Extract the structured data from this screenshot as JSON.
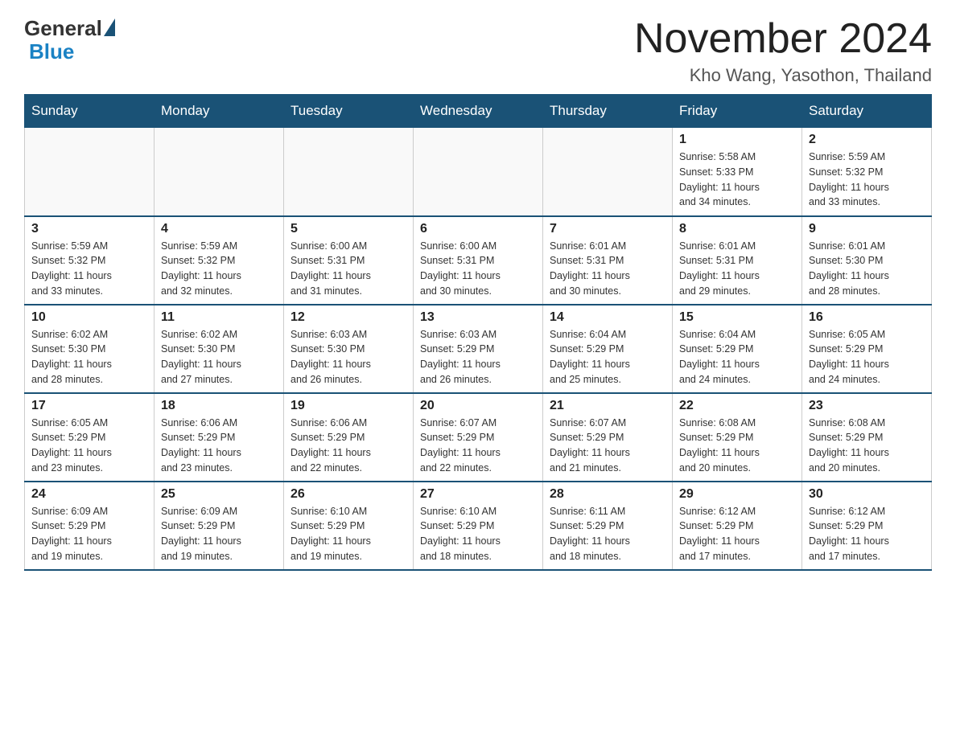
{
  "logo": {
    "general": "General",
    "blue": "Blue"
  },
  "header": {
    "title": "November 2024",
    "location": "Kho Wang, Yasothon, Thailand"
  },
  "weekdays": [
    "Sunday",
    "Monday",
    "Tuesday",
    "Wednesday",
    "Thursday",
    "Friday",
    "Saturday"
  ],
  "weeks": [
    [
      {
        "day": "",
        "info": ""
      },
      {
        "day": "",
        "info": ""
      },
      {
        "day": "",
        "info": ""
      },
      {
        "day": "",
        "info": ""
      },
      {
        "day": "",
        "info": ""
      },
      {
        "day": "1",
        "info": "Sunrise: 5:58 AM\nSunset: 5:33 PM\nDaylight: 11 hours\nand 34 minutes."
      },
      {
        "day": "2",
        "info": "Sunrise: 5:59 AM\nSunset: 5:32 PM\nDaylight: 11 hours\nand 33 minutes."
      }
    ],
    [
      {
        "day": "3",
        "info": "Sunrise: 5:59 AM\nSunset: 5:32 PM\nDaylight: 11 hours\nand 33 minutes."
      },
      {
        "day": "4",
        "info": "Sunrise: 5:59 AM\nSunset: 5:32 PM\nDaylight: 11 hours\nand 32 minutes."
      },
      {
        "day": "5",
        "info": "Sunrise: 6:00 AM\nSunset: 5:31 PM\nDaylight: 11 hours\nand 31 minutes."
      },
      {
        "day": "6",
        "info": "Sunrise: 6:00 AM\nSunset: 5:31 PM\nDaylight: 11 hours\nand 30 minutes."
      },
      {
        "day": "7",
        "info": "Sunrise: 6:01 AM\nSunset: 5:31 PM\nDaylight: 11 hours\nand 30 minutes."
      },
      {
        "day": "8",
        "info": "Sunrise: 6:01 AM\nSunset: 5:31 PM\nDaylight: 11 hours\nand 29 minutes."
      },
      {
        "day": "9",
        "info": "Sunrise: 6:01 AM\nSunset: 5:30 PM\nDaylight: 11 hours\nand 28 minutes."
      }
    ],
    [
      {
        "day": "10",
        "info": "Sunrise: 6:02 AM\nSunset: 5:30 PM\nDaylight: 11 hours\nand 28 minutes."
      },
      {
        "day": "11",
        "info": "Sunrise: 6:02 AM\nSunset: 5:30 PM\nDaylight: 11 hours\nand 27 minutes."
      },
      {
        "day": "12",
        "info": "Sunrise: 6:03 AM\nSunset: 5:30 PM\nDaylight: 11 hours\nand 26 minutes."
      },
      {
        "day": "13",
        "info": "Sunrise: 6:03 AM\nSunset: 5:29 PM\nDaylight: 11 hours\nand 26 minutes."
      },
      {
        "day": "14",
        "info": "Sunrise: 6:04 AM\nSunset: 5:29 PM\nDaylight: 11 hours\nand 25 minutes."
      },
      {
        "day": "15",
        "info": "Sunrise: 6:04 AM\nSunset: 5:29 PM\nDaylight: 11 hours\nand 24 minutes."
      },
      {
        "day": "16",
        "info": "Sunrise: 6:05 AM\nSunset: 5:29 PM\nDaylight: 11 hours\nand 24 minutes."
      }
    ],
    [
      {
        "day": "17",
        "info": "Sunrise: 6:05 AM\nSunset: 5:29 PM\nDaylight: 11 hours\nand 23 minutes."
      },
      {
        "day": "18",
        "info": "Sunrise: 6:06 AM\nSunset: 5:29 PM\nDaylight: 11 hours\nand 23 minutes."
      },
      {
        "day": "19",
        "info": "Sunrise: 6:06 AM\nSunset: 5:29 PM\nDaylight: 11 hours\nand 22 minutes."
      },
      {
        "day": "20",
        "info": "Sunrise: 6:07 AM\nSunset: 5:29 PM\nDaylight: 11 hours\nand 22 minutes."
      },
      {
        "day": "21",
        "info": "Sunrise: 6:07 AM\nSunset: 5:29 PM\nDaylight: 11 hours\nand 21 minutes."
      },
      {
        "day": "22",
        "info": "Sunrise: 6:08 AM\nSunset: 5:29 PM\nDaylight: 11 hours\nand 20 minutes."
      },
      {
        "day": "23",
        "info": "Sunrise: 6:08 AM\nSunset: 5:29 PM\nDaylight: 11 hours\nand 20 minutes."
      }
    ],
    [
      {
        "day": "24",
        "info": "Sunrise: 6:09 AM\nSunset: 5:29 PM\nDaylight: 11 hours\nand 19 minutes."
      },
      {
        "day": "25",
        "info": "Sunrise: 6:09 AM\nSunset: 5:29 PM\nDaylight: 11 hours\nand 19 minutes."
      },
      {
        "day": "26",
        "info": "Sunrise: 6:10 AM\nSunset: 5:29 PM\nDaylight: 11 hours\nand 19 minutes."
      },
      {
        "day": "27",
        "info": "Sunrise: 6:10 AM\nSunset: 5:29 PM\nDaylight: 11 hours\nand 18 minutes."
      },
      {
        "day": "28",
        "info": "Sunrise: 6:11 AM\nSunset: 5:29 PM\nDaylight: 11 hours\nand 18 minutes."
      },
      {
        "day": "29",
        "info": "Sunrise: 6:12 AM\nSunset: 5:29 PM\nDaylight: 11 hours\nand 17 minutes."
      },
      {
        "day": "30",
        "info": "Sunrise: 6:12 AM\nSunset: 5:29 PM\nDaylight: 11 hours\nand 17 minutes."
      }
    ]
  ]
}
